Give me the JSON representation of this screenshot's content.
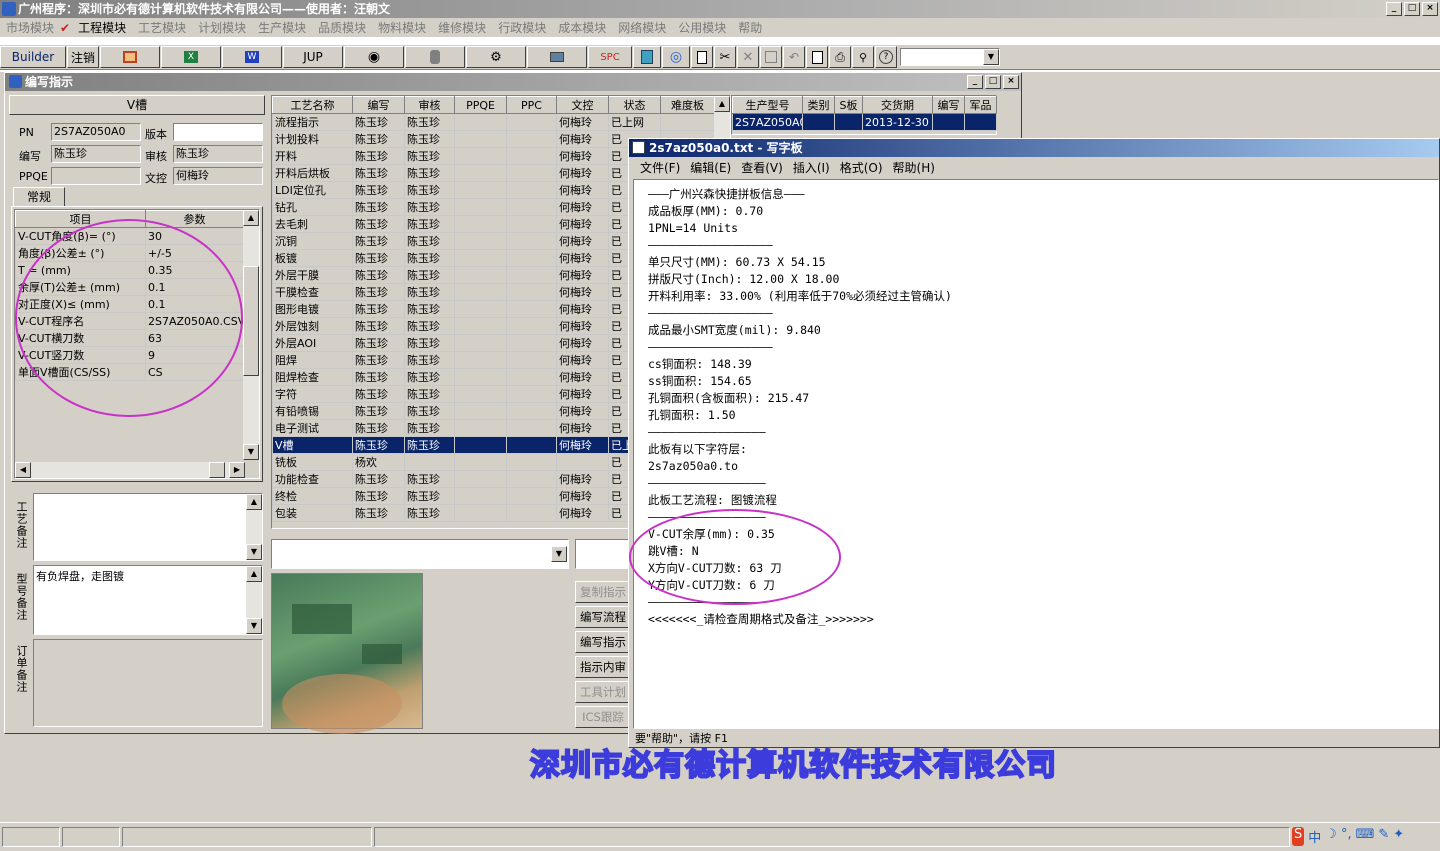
{
  "app": {
    "title": "广州程序：深圳市必有德计算机软件技术有限公司——使用者：汪朝文",
    "window_controls": [
      "_",
      "□",
      "×"
    ]
  },
  "menu": [
    "市场模块",
    "工程模块",
    "工艺模块",
    "计划模块",
    "生产模块",
    "品质模块",
    "物料模块",
    "维修模块",
    "行政模块",
    "成本模块",
    "网络模块",
    "公用模块",
    "帮助"
  ],
  "menu_active_index": 1,
  "toolbar": {
    "builder": "Builder",
    "logout": "注销",
    "jup": "JUP",
    "spc": "SPC",
    "icons": [
      "access-icon",
      "excel-icon",
      "word-icon",
      "jup-icon",
      "eye-icon",
      "database-icon",
      "gear-network-icon",
      "computer-icon",
      "spc-icon",
      "calculator-icon",
      "internet-icon",
      "new-doc-icon",
      "cut-icon",
      "delete-icon",
      "save-icon",
      "undo-icon",
      "print-preview-icon",
      "print-icon",
      "find-icon",
      "help-icon"
    ]
  },
  "child": {
    "title": "编写指示",
    "header": "V槽",
    "pn_label": "PN",
    "pn_value": "2S7AZ050A0",
    "version_label": "版本",
    "version_value": "",
    "writer_label": "编写",
    "writer_value": "陈玉珍",
    "review_label": "审核",
    "review_value": "陈玉珍",
    "ppqe_label": "PPQE",
    "ppqe_value": "",
    "doc_label": "文控",
    "doc_value": "何梅玲",
    "tab": "常规",
    "param_headers": [
      "项目",
      "参数"
    ],
    "params": [
      [
        "V-CUT角度(β)= (°)",
        "30"
      ],
      [
        "角度(β)公差± (°)",
        "+/-5"
      ],
      [
        "T = (mm)",
        "0.35"
      ],
      [
        "余厚(T)公差± (mm)",
        "0.1"
      ],
      [
        "对正度(X)≤ (mm)",
        "0.1"
      ],
      [
        "V-CUT程序名",
        "2S7AZ050A0.CSV"
      ],
      [
        "V-CUT横刀数",
        "63"
      ],
      [
        "V-CUT竖刀数",
        "9"
      ],
      [
        "单面V槽面(CS/SS)",
        "CS"
      ]
    ],
    "remark_labels": [
      "工艺备注",
      "型号备注",
      "订单备注"
    ],
    "remark_values": [
      "",
      "有负焊盘，走图镀",
      ""
    ],
    "process_headers": [
      "工艺名称",
      "编写",
      "审核",
      "PPQE",
      "PPC",
      "文控",
      "状态",
      "难度板"
    ],
    "process_rows": [
      [
        "流程指示",
        "陈玉珍",
        "陈玉珍",
        "",
        "",
        "何梅玲",
        "已上网",
        ""
      ],
      [
        "计划投料",
        "陈玉珍",
        "陈玉珍",
        "",
        "",
        "何梅玲",
        "已",
        ""
      ],
      [
        "开料",
        "陈玉珍",
        "陈玉珍",
        "",
        "",
        "何梅玲",
        "已",
        ""
      ],
      [
        "开料后烘板",
        "陈玉珍",
        "陈玉珍",
        "",
        "",
        "何梅玲",
        "已",
        ""
      ],
      [
        "LDI定位孔",
        "陈玉珍",
        "陈玉珍",
        "",
        "",
        "何梅玲",
        "已",
        ""
      ],
      [
        "钻孔",
        "陈玉珍",
        "陈玉珍",
        "",
        "",
        "何梅玲",
        "已",
        ""
      ],
      [
        "去毛刺",
        "陈玉珍",
        "陈玉珍",
        "",
        "",
        "何梅玲",
        "已",
        ""
      ],
      [
        "沉铜",
        "陈玉珍",
        "陈玉珍",
        "",
        "",
        "何梅玲",
        "已",
        ""
      ],
      [
        "板镀",
        "陈玉珍",
        "陈玉珍",
        "",
        "",
        "何梅玲",
        "已",
        ""
      ],
      [
        "外层干膜",
        "陈玉珍",
        "陈玉珍",
        "",
        "",
        "何梅玲",
        "已",
        ""
      ],
      [
        "干膜检查",
        "陈玉珍",
        "陈玉珍",
        "",
        "",
        "何梅玲",
        "已",
        ""
      ],
      [
        "图形电镀",
        "陈玉珍",
        "陈玉珍",
        "",
        "",
        "何梅玲",
        "已",
        ""
      ],
      [
        "外层蚀刻",
        "陈玉珍",
        "陈玉珍",
        "",
        "",
        "何梅玲",
        "已",
        ""
      ],
      [
        "外层AOI",
        "陈玉珍",
        "陈玉珍",
        "",
        "",
        "何梅玲",
        "已",
        ""
      ],
      [
        "阻焊",
        "陈玉珍",
        "陈玉珍",
        "",
        "",
        "何梅玲",
        "已",
        ""
      ],
      [
        "阻焊检查",
        "陈玉珍",
        "陈玉珍",
        "",
        "",
        "何梅玲",
        "已",
        ""
      ],
      [
        "字符",
        "陈玉珍",
        "陈玉珍",
        "",
        "",
        "何梅玲",
        "已",
        ""
      ],
      [
        "有铅喷锡",
        "陈玉珍",
        "陈玉珍",
        "",
        "",
        "何梅玲",
        "已",
        ""
      ],
      [
        "电子测试",
        "陈玉珍",
        "陈玉珍",
        "",
        "",
        "何梅玲",
        "已",
        ""
      ],
      [
        "V槽",
        "陈玉珍",
        "陈玉珍",
        "",
        "",
        "何梅玲",
        "已上",
        ""
      ],
      [
        "铣板",
        "杨欢",
        "",
        "",
        "",
        "",
        "已",
        ""
      ],
      [
        "功能检查",
        "陈玉珍",
        "陈玉珍",
        "",
        "",
        "何梅玲",
        "已",
        ""
      ],
      [
        "终检",
        "陈玉珍",
        "陈玉珍",
        "",
        "",
        "何梅玲",
        "已",
        ""
      ],
      [
        "包装",
        "陈玉珍",
        "陈玉珍",
        "",
        "",
        "何梅玲",
        "已",
        ""
      ]
    ],
    "selected_row": 19,
    "order_headers": [
      "生产型号",
      "类别",
      "S板",
      "交货期",
      "编写",
      "军品"
    ],
    "order_row": [
      "2S7AZ050A0",
      "",
      "",
      "2013-12-30",
      "",
      ""
    ],
    "buttons": [
      "复制指示",
      "编写流程",
      "编写指示",
      "指示内审",
      "工具计划",
      "ICS跟踪"
    ],
    "buttons_disabled": [
      true,
      false,
      false,
      false,
      true,
      true
    ]
  },
  "notepad": {
    "title": "2s7az050a0.txt - 写字板",
    "menu": [
      "文件(F)",
      "编辑(E)",
      "查看(V)",
      "插入(I)",
      "格式(O)",
      "帮助(H)"
    ],
    "lines": [
      "———广州兴森快捷拼板信息———",
      "成品板厚(MM): 0.70",
      "1PNL=14 Units",
      "——————————————————",
      "单只尺寸(MM): 60.73 X 54.15",
      "拼版尺寸(Inch): 12.00 X 18.00",
      "开料利用率: 33.00% (利用率低于70%必须经过主管确认)",
      "——————————————————",
      "成品最小SMT宽度(mil): 9.840",
      "——————————————————",
      "cs铜面积: 148.39",
      "ss铜面积: 154.65",
      "孔铜面积(含板面积): 215.47",
      "孔铜面积: 1.50",
      "—————————————————",
      "此板有以下字符层:",
      "2s7az050a0.to",
      "—————————————————",
      "此板工艺流程: 图镀流程",
      "—————————————————",
      "V-CUT余厚(mm): 0.35",
      "跳V槽: N",
      "X方向V-CUT刀数: 63 刀",
      "Y方向V-CUT刀数: 6 刀",
      "—————————————————",
      "<<<<<<<_请检查周期格式及备注_>>>>>>>"
    ],
    "status": "要\"帮助\"，请按 F1"
  },
  "watermark": "深圳市必有德计算机软件技术有限公司",
  "tray": [
    "S",
    "中",
    "☽",
    "°,",
    "⌨",
    "✎",
    "✦"
  ],
  "colors": {
    "face": "#d4d0c8",
    "selection": "#0a246a",
    "highlight_circle": "#c832c8",
    "watermark": "#3c3cdc"
  }
}
